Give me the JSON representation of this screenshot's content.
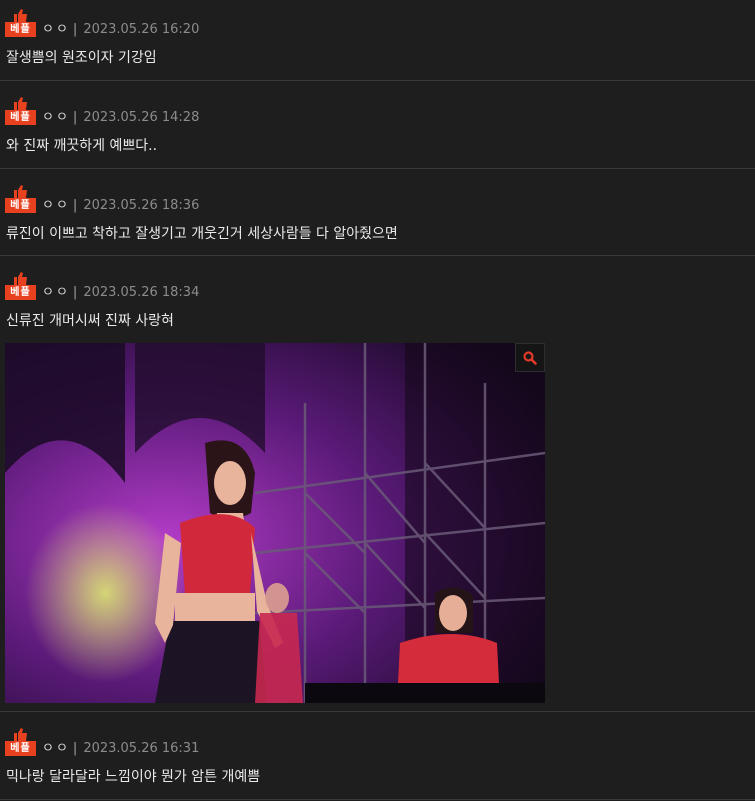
{
  "colors": {
    "background": "#1e1e1e",
    "badge": "#e8411f",
    "divider": "#3a3a3a",
    "date_text": "#8c8c8c",
    "zoom_icon": "#e23a2a"
  },
  "badge_label": "베플",
  "comments": [
    {
      "nickname": "ㅇㅇ",
      "separator": "|",
      "date": "2023.05.26 16:20",
      "text": "잘생쁨의 원조이자 기강임"
    },
    {
      "nickname": "ㅇㅇ",
      "separator": "|",
      "date": "2023.05.26 14:28",
      "text": "와 진짜 깨끗하게 예쁘다.."
    },
    {
      "nickname": "ㅇㅇ",
      "separator": "|",
      "date": "2023.05.26 18:36",
      "text": "류진이 이쁘고 착하고 잘생기고 개웃긴거 세상사람들 다 알아줬으면"
    },
    {
      "nickname": "ㅇㅇ",
      "separator": "|",
      "date": "2023.05.26 18:34",
      "text": "신류진 개머시써 진짜 사랑혀",
      "image_icon": "zoom-icon"
    },
    {
      "nickname": "ㅇㅇ",
      "separator": "|",
      "date": "2023.05.26 16:31",
      "text": "믹나랑 달라달라 느낌이야 뭔가 암튼 개예쁨"
    }
  ]
}
